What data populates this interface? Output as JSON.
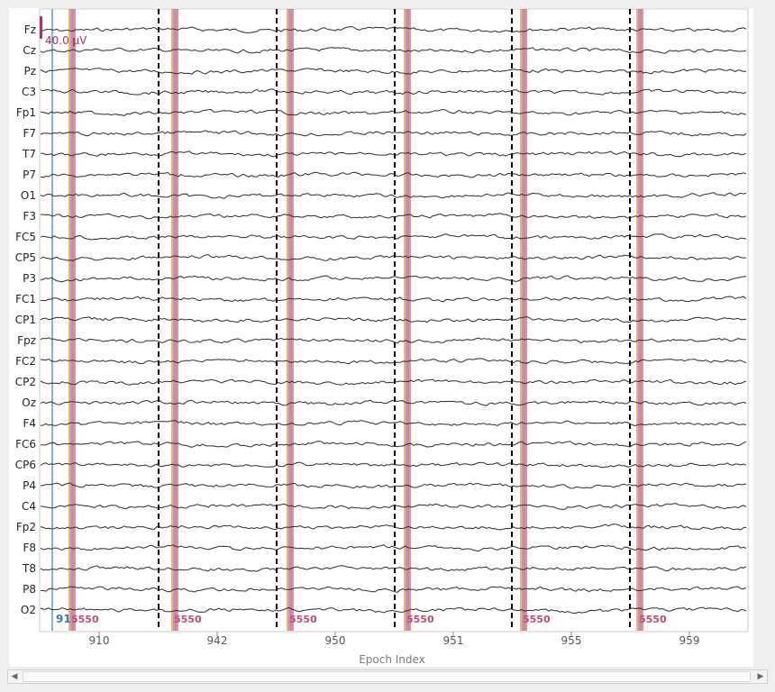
{
  "channels": [
    "Fz",
    "Cz",
    "Pz",
    "C3",
    "Fp1",
    "F7",
    "T7",
    "P7",
    "O1",
    "F3",
    "FC5",
    "CP5",
    "P3",
    "FC1",
    "CP1",
    "Fpz",
    "FC2",
    "CP2",
    "Oz",
    "F4",
    "FC6",
    "CP6",
    "P4",
    "C4",
    "Fp2",
    "F8",
    "T8",
    "P8",
    "O2"
  ],
  "x_axis": {
    "title": "Epoch Index",
    "ticks": [
      "910",
      "942",
      "950",
      "951",
      "955",
      "959"
    ]
  },
  "scale_bar": {
    "label": "40.0 µV"
  },
  "epochs": {
    "count": 6,
    "visible_range": [
      "910",
      "959"
    ]
  },
  "annotations": {
    "first_marker_label": "91",
    "event_label_fragments": [
      "5550",
      "5550",
      "5550",
      "5550",
      "5550",
      "5550"
    ]
  },
  "colors": {
    "trace": "#2b2b2b",
    "epoch_boundary": "#000000",
    "scale_bar": "#b0306b",
    "marker_blue": "#3a7fae",
    "event_orange": "#d38b1b",
    "event_purple": "#8c4fa0",
    "event_pink": "#c34a7a",
    "event_red": "#c0392b"
  },
  "icons": {
    "scroll_left": "triangle-left-icon",
    "scroll_right": "triangle-right-icon"
  }
}
